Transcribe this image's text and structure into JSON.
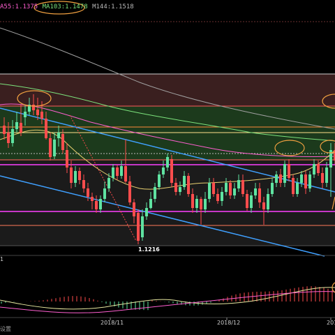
{
  "legend": {
    "ma1": "A55:1.1375",
    "ma2": "MA103:1.1478",
    "ma3": "M144:1.1518"
  },
  "low_label": "1.1216",
  "sub_indicator_label": "1",
  "settings_label": "设置",
  "x_axis": {
    "labels": [
      "2018/11",
      "2018/12",
      "201"
    ]
  },
  "colors": {
    "background": "#000000",
    "up_candle": "#5fe3a1",
    "down_candle": "#ff4d4d",
    "ma_pink": "#ff5fd0",
    "ma_green": "#7ce37c",
    "ma_grey": "#9a9a9a",
    "trend_blue": "#3fa0ff",
    "annotation_orange": "#f0a040",
    "level_magenta": "#ff40ff",
    "level_red": "#ff5a5a",
    "zone_red": "#3a1f1f",
    "zone_green": "#1c3a1c"
  },
  "chart_data": {
    "type": "candlestick",
    "x_labels": [
      "2018/11",
      "2018/12",
      "201"
    ],
    "annotated_low": 1.1216,
    "moving_averages": [
      {
        "name": "A55",
        "value": 1.1375
      },
      {
        "name": "MA103",
        "value": 1.1478
      },
      {
        "name": "M144",
        "value": 1.1518
      }
    ]
  }
}
